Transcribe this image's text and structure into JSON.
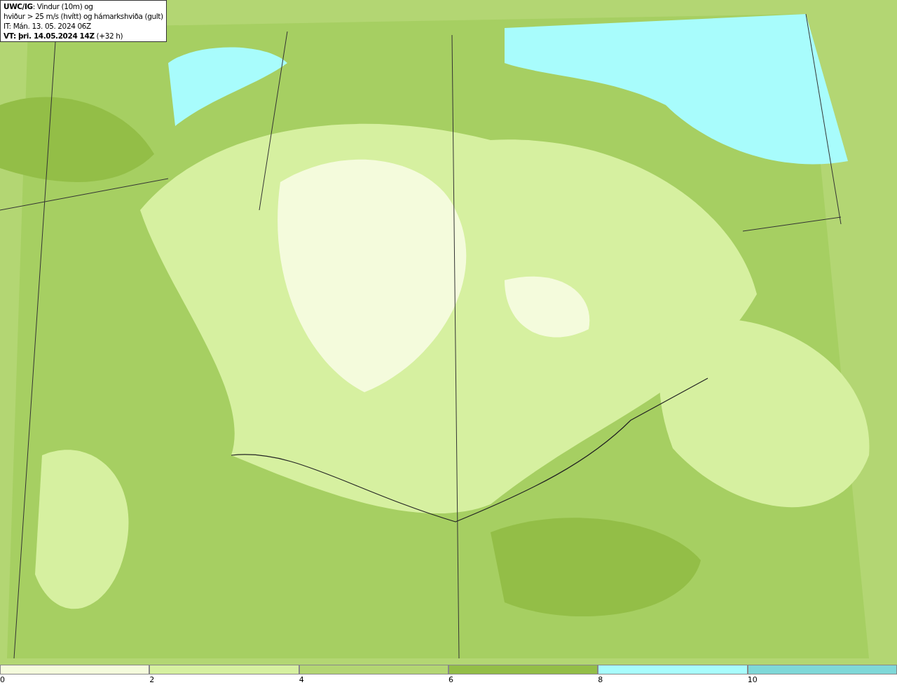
{
  "map": {
    "title_lines": [
      "**UWC/IG**: Vindur (10m) og",
      "hviður > 25 m/s (hvítt) og hámarkshviða (gult)",
      "IT: Mán. 13. 05. 2024 06Z",
      "**VT: þri. 14.05.2024 14Z** (+32 h)"
    ]
  },
  "legend": [
    {
      "label": "0",
      "color": "#f4fbdc"
    },
    {
      "label": "2",
      "color": "#d6f0a0"
    },
    {
      "label": "4",
      "color": "#b3d673"
    },
    {
      "label": "6",
      "color": "#93be47"
    },
    {
      "label": "8",
      "color": "#a8fcfc"
    },
    {
      "label": "10",
      "color": "#7fd8d8"
    }
  ]
}
